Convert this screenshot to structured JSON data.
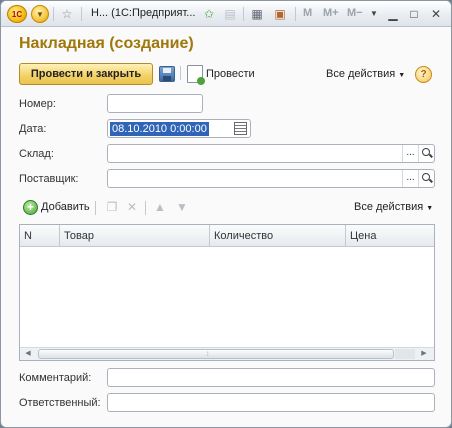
{
  "titlebar": {
    "logo_text": "1С",
    "tab_title": "Н...  (1С:Предприят...",
    "memory_buttons": [
      "M",
      "M+",
      "M−"
    ]
  },
  "form": {
    "title": "Накладная (создание)"
  },
  "toolbar": {
    "post_and_close": "Провести и закрыть",
    "post": "Провести",
    "all_actions": "Все действия",
    "help": "?"
  },
  "fields": {
    "number_label": "Номер:",
    "number_value": "",
    "date_label": "Дата:",
    "date_value": "08.10.2010  0:00:00",
    "warehouse_label": "Склад:",
    "warehouse_value": "",
    "supplier_label": "Поставщик:",
    "supplier_value": "",
    "comment_label": "Комментарий:",
    "comment_value": "",
    "responsible_label": "Ответственный:",
    "responsible_value": ""
  },
  "table_toolbar": {
    "add": "Добавить",
    "all_actions": "Все действия"
  },
  "table": {
    "columns": [
      "N",
      "Товар",
      "Количество",
      "Цена"
    ],
    "rows": []
  },
  "colors": {
    "title": "#a0770a",
    "primary_button": "#f4d36a",
    "selection": "#3064b8"
  }
}
